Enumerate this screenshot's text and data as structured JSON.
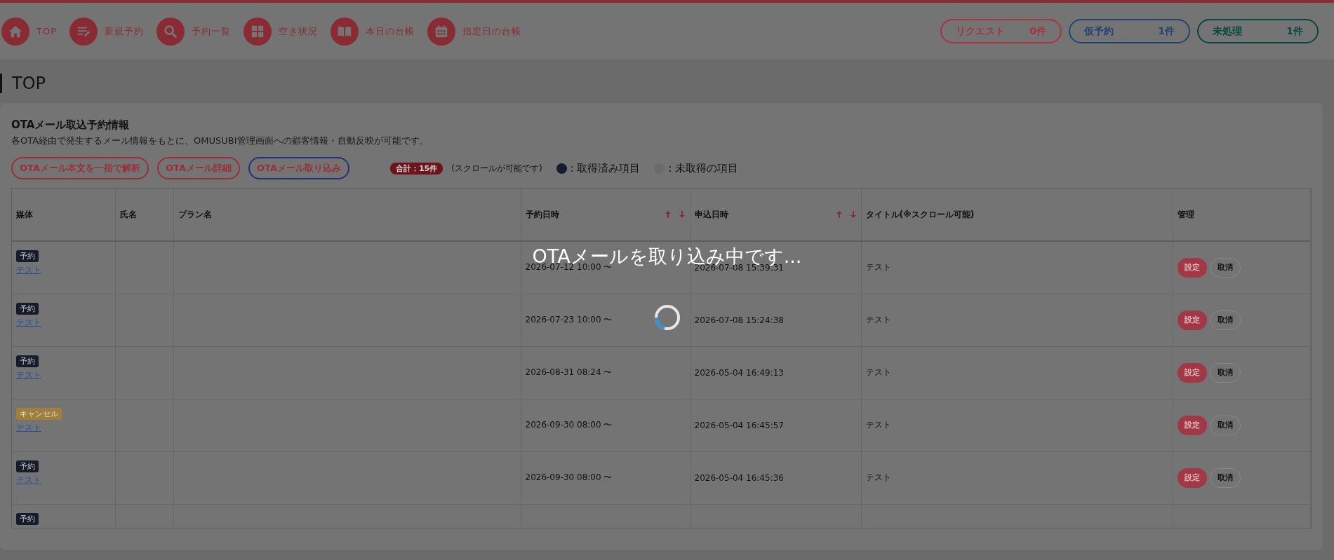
{
  "nav": {
    "items": [
      {
        "label": "TOP"
      },
      {
        "label": "新規予約"
      },
      {
        "label": "予約一覧"
      },
      {
        "label": "空き状況"
      },
      {
        "label": "本日の台帳"
      },
      {
        "label": "指定日の台帳"
      }
    ],
    "counters": [
      {
        "label": "リクエスト",
        "count": "0件",
        "color": "#a8343c"
      },
      {
        "label": "仮予約",
        "count": "1件",
        "color": "#1f4470"
      },
      {
        "label": "未処理",
        "count": "1件",
        "color": "#04483e"
      }
    ]
  },
  "page_title": "TOP",
  "panel": {
    "title": "OTAメール取込予約情報",
    "description": "各OTA経由で発生するメール情報をもとに、OMUSUBI管理画面への顧客情報・自動反映が可能です。",
    "actions": [
      {
        "label": "OTAメール本文を一括で解析",
        "selected": false
      },
      {
        "label": "OTAメール詳細",
        "selected": false
      },
      {
        "label": "OTAメール取り込み",
        "selected": true
      }
    ],
    "total": "合計：15件",
    "scroll_note": "(スクロールが可能です)",
    "legend": [
      {
        "label": ": 取得済み項目",
        "color": "#171c2a"
      },
      {
        "label": ": 未取得の項目",
        "color": "#6a6a70"
      }
    ]
  },
  "table": {
    "columns": [
      {
        "label": "媒体",
        "sortable": false
      },
      {
        "label": "氏名",
        "sortable": false
      },
      {
        "label": "プラン名",
        "sortable": false
      },
      {
        "label": "予約日時",
        "sortable": true
      },
      {
        "label": "申込日時",
        "sortable": true
      },
      {
        "label": "タイトル(※スクロール可能)",
        "sortable": false
      },
      {
        "label": "管理",
        "sortable": false
      }
    ],
    "rows": [
      {
        "kind": "reserved",
        "badge": "予約",
        "link": "テスト",
        "reserved_at": "2026-07-12 10:00 〜",
        "applied_at": "2026-07-08 15:39:31",
        "title": "テスト",
        "buttons": [
          "設定",
          "取消"
        ]
      },
      {
        "kind": "reserved",
        "badge": "予約",
        "link": "テスト",
        "reserved_at": "2026-07-23 10:00 〜",
        "applied_at": "2026-07-08 15:24:38",
        "title": "テスト",
        "buttons": [
          "設定",
          "取消"
        ]
      },
      {
        "kind": "reserved",
        "badge": "予約",
        "link": "テスト",
        "reserved_at": "2026-08-31 08:24 〜",
        "applied_at": "2026-05-04 16:49:13",
        "title": "テスト",
        "buttons": [
          "設定",
          "取消"
        ]
      },
      {
        "kind": "cancel",
        "badge": "キャンセル",
        "link": "テスト",
        "reserved_at": "2026-09-30 08:00 〜",
        "applied_at": "2026-05-04 16:45:57",
        "title": "テスト",
        "buttons": [
          "設定",
          "取消"
        ]
      },
      {
        "kind": "reserved",
        "badge": "予約",
        "link": "テスト",
        "reserved_at": "2026-09-30 08:00 〜",
        "applied_at": "2026-05-04 16:45:36",
        "title": "テスト",
        "buttons": [
          "設定",
          "取消"
        ]
      },
      {
        "kind": "reserved",
        "badge": "予約"
      }
    ]
  },
  "loading": {
    "message": "OTAメールを取り込み中です..."
  }
}
